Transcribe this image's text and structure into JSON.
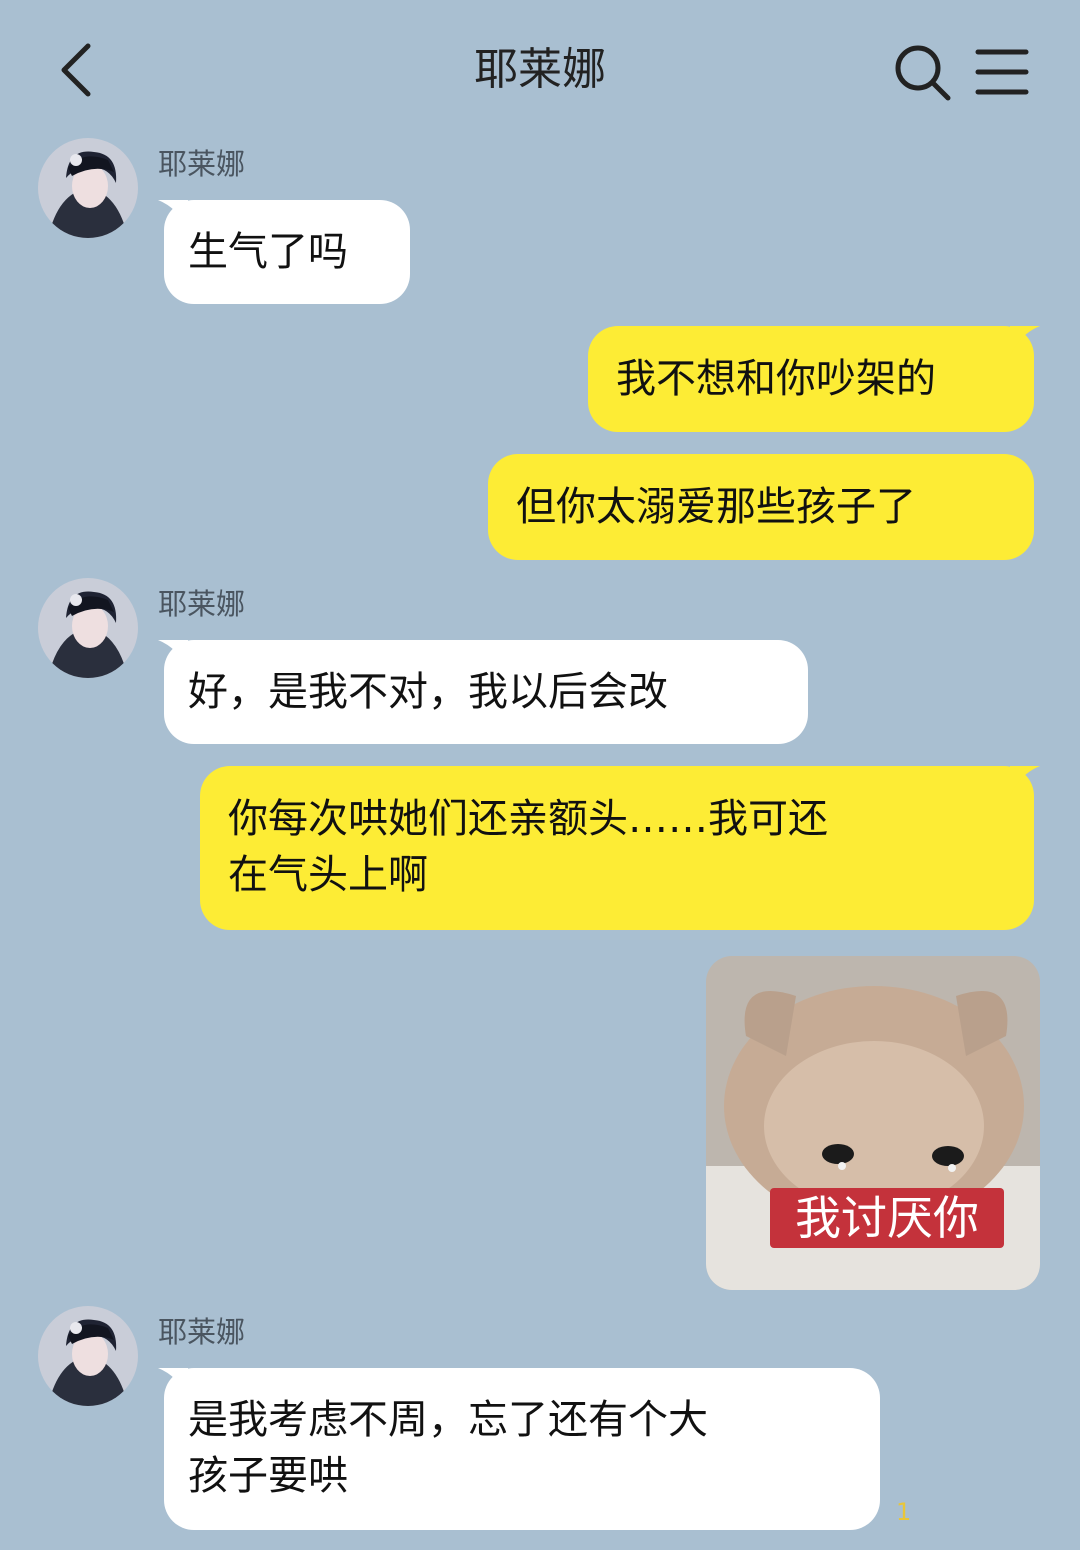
{
  "header": {
    "title": "耶莱娜",
    "icons": {
      "back": "chevron-left-icon",
      "search": "search-icon",
      "menu": "menu-icon"
    }
  },
  "messages": [
    {
      "from": "contact",
      "sender": "耶莱娜",
      "text": "生气了吗"
    },
    {
      "from": "me",
      "text": "我不想和你吵架的"
    },
    {
      "from": "me",
      "text": "但你太溺爱那些孩子了"
    },
    {
      "from": "contact",
      "sender": "耶莱娜",
      "text": "好，是我不对，我以后会改"
    },
    {
      "from": "me",
      "lines": [
        "你每次哄她们还亲额头……我可还",
        "在气头上啊"
      ]
    },
    {
      "from": "me",
      "sticker_caption": "我讨厌你"
    },
    {
      "from": "contact",
      "sender": "耶莱娜",
      "lines": [
        "是我考虑不周，忘了还有个大",
        "孩子要哄"
      ]
    }
  ],
  "unread_count": "1",
  "colors": {
    "background": "#a9bfd1",
    "incoming_bubble": "#ffffff",
    "outgoing_bubble": "#fdec35",
    "sticker_caption_bg": "#c4323b",
    "badge": "#e8c63a"
  }
}
